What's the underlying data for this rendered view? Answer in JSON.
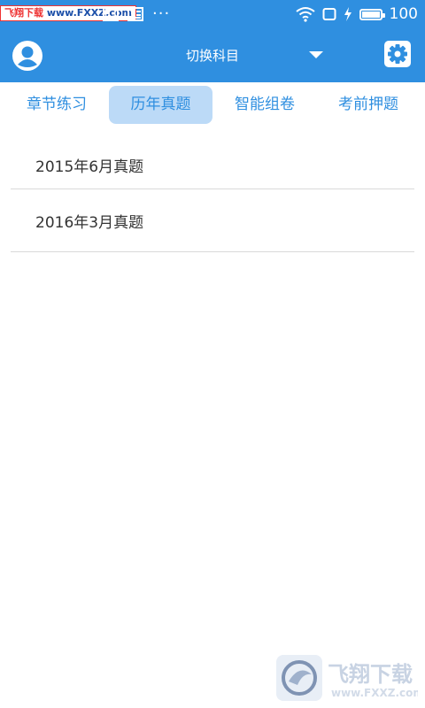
{
  "status_bar": {
    "watermark_left": "飞翔下载",
    "watermark_right": "www.FXXZ.com",
    "dots": "···",
    "battery_level": 100,
    "battery_text": "100"
  },
  "header": {
    "title": "切换科目",
    "avatar_icon": "user-circle-icon",
    "settings_icon": "gear-icon",
    "color": "#2f8fe0"
  },
  "tabs": [
    {
      "label": "章节练习",
      "active": false
    },
    {
      "label": "历年真题",
      "active": true
    },
    {
      "label": "智能组卷",
      "active": false
    },
    {
      "label": "考前押题",
      "active": false
    }
  ],
  "list": {
    "items": [
      {
        "label": "2015年6月真题"
      },
      {
        "label": "2016年3月真题"
      }
    ]
  },
  "watermark_logo": {
    "text": "飞翔下载",
    "url": "www.FXXZ.com"
  }
}
